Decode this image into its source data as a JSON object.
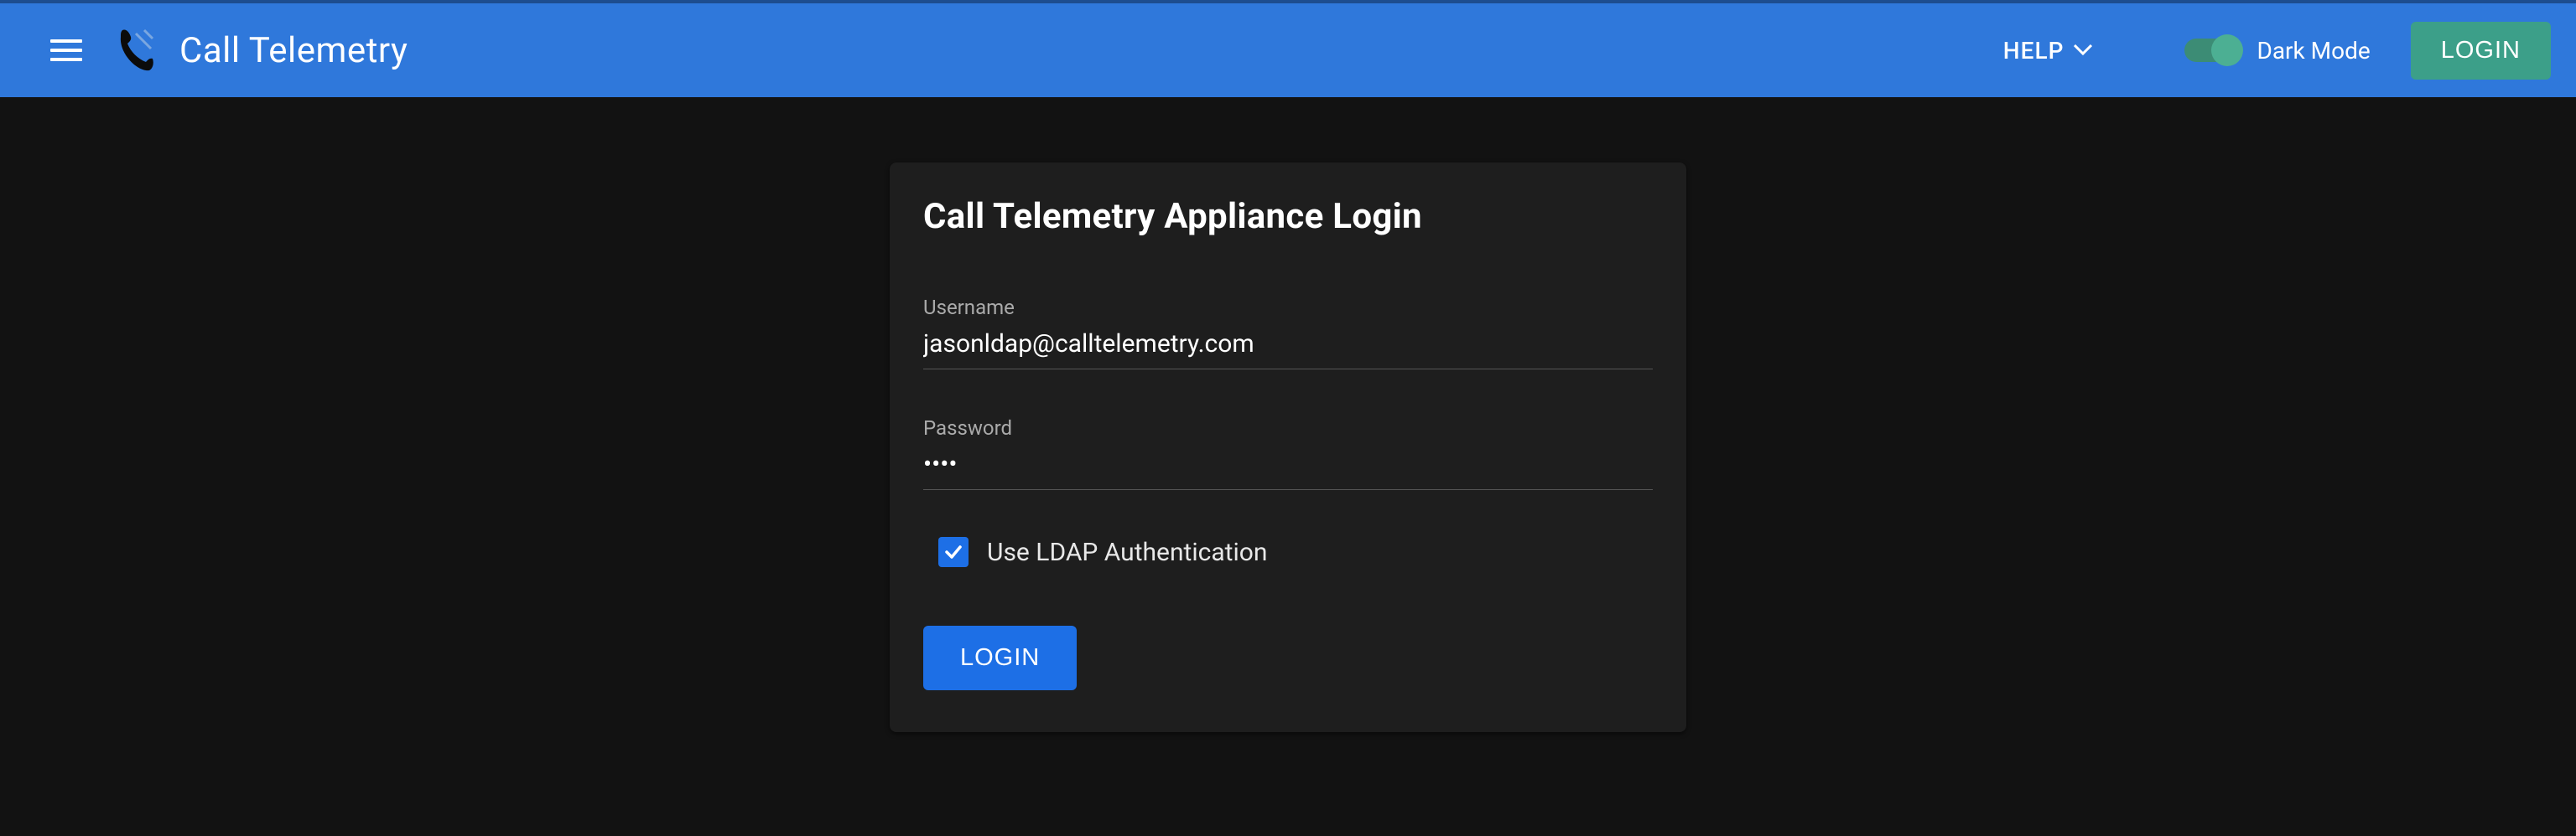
{
  "header": {
    "app_title": "Call Telemetry",
    "help_label": "HELP",
    "dark_mode_label": "Dark Mode",
    "login_button": "LOGIN"
  },
  "login_card": {
    "title": "Call Telemetry Appliance Login",
    "username_label": "Username",
    "username_value": "jasonldap@calltelemetry.com",
    "password_label": "Password",
    "password_value": "••••",
    "ldap_checkbox_label": "Use LDAP Authentication",
    "ldap_checked": true,
    "submit_label": "LOGIN"
  }
}
